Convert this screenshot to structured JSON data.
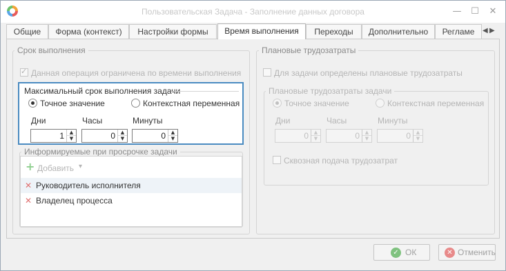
{
  "window": {
    "title": "Пользовательская Задача - Заполнение данных договора",
    "minimize_glyph": "—",
    "maximize_glyph": "☐",
    "close_glyph": "✕"
  },
  "tabs": [
    {
      "label": "Общие",
      "active": false
    },
    {
      "label": "Форма (контекст)",
      "active": false
    },
    {
      "label": "Настройки формы",
      "active": false
    },
    {
      "label": "Время выполнения",
      "active": true
    },
    {
      "label": "Переходы",
      "active": false
    },
    {
      "label": "Дополнительно",
      "active": false
    },
    {
      "label": "Регламе",
      "active": false
    }
  ],
  "tab_arrows": {
    "left": "◀",
    "right": "▶"
  },
  "left_panel": {
    "title": "Срок выполнения",
    "limit_checkbox": {
      "label": "Данная операция ограничена по времени выполнения",
      "checked": true
    },
    "max_term": {
      "title": "Максимальный срок выполнения задачи",
      "radio_exact": {
        "label": "Точное значение",
        "selected": true
      },
      "radio_context": {
        "label": "Контекстная переменная",
        "selected": false
      },
      "days": {
        "label": "Дни",
        "value": "1"
      },
      "hours": {
        "label": "Часы",
        "value": "0"
      },
      "minutes": {
        "label": "Минуты",
        "value": "0"
      }
    },
    "notify": {
      "title": "Информируемые при просрочке задачи",
      "add_label": "Добавить",
      "dropdown_glyph": "▾",
      "items": [
        {
          "label": "Руководитель исполнителя"
        },
        {
          "label": "Владелец процесса"
        }
      ]
    }
  },
  "right_panel": {
    "title": "Плановые трудозатраты",
    "planned_checkbox": {
      "label": "Для задачи определены плановые трудозатраты",
      "checked": false
    },
    "planned": {
      "title": "Плановые трудозатраты задачи",
      "radio_exact": {
        "label": "Точное значение",
        "selected": true
      },
      "radio_context": {
        "label": "Контекстная переменная",
        "selected": false
      },
      "days": {
        "label": "Дни",
        "value": "0"
      },
      "hours": {
        "label": "Часы",
        "value": "0"
      },
      "minutes": {
        "label": "Минуты",
        "value": "0"
      }
    },
    "through_checkbox": {
      "label": "Сквозная подача трудозатрат",
      "checked": false
    }
  },
  "footer": {
    "ok_label": "ОК",
    "cancel_label": "Отменить"
  },
  "colors": {
    "highlight_border": "#4a8bc1",
    "ok_icon": "#7fc27f",
    "cancel_icon": "#e88a8a"
  }
}
